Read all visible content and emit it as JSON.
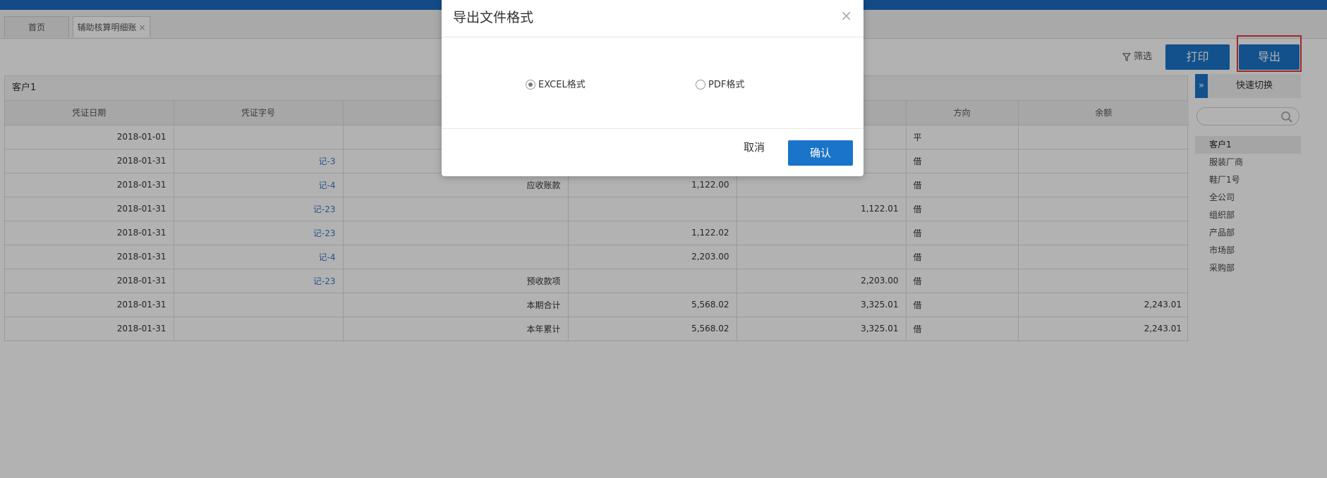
{
  "tabs": [
    {
      "label": "首页",
      "closable": false,
      "active": false
    },
    {
      "label": "辅助核算明细账",
      "closable": true,
      "active": true
    }
  ],
  "toolbar": {
    "filter_label": "筛选",
    "print_label": "打印",
    "export_label": "导出"
  },
  "ledger": {
    "title": "客户1",
    "columns": [
      "凭证日期",
      "凭证字号",
      "",
      "",
      "",
      "方向",
      "余额"
    ],
    "rows": [
      {
        "date": "2018-01-01",
        "voucher": "",
        "summary": "",
        "debit": "",
        "credit": "",
        "direction": "平",
        "balance": ""
      },
      {
        "date": "2018-01-31",
        "voucher": "记-3",
        "summary": "",
        "debit": "",
        "credit": "",
        "direction": "借",
        "balance": ""
      },
      {
        "date": "2018-01-31",
        "voucher": "记-4",
        "summary": "应收账款",
        "debit": "1,122.00",
        "credit": "",
        "direction": "借",
        "balance": ""
      },
      {
        "date": "2018-01-31",
        "voucher": "记-23",
        "summary": "",
        "debit": "",
        "credit": "1,122.01",
        "direction": "借",
        "balance": ""
      },
      {
        "date": "2018-01-31",
        "voucher": "记-23",
        "summary": "",
        "debit": "1,122.02",
        "credit": "",
        "direction": "借",
        "balance": ""
      },
      {
        "date": "2018-01-31",
        "voucher": "记-4",
        "summary": "",
        "debit": "2,203.00",
        "credit": "",
        "direction": "借",
        "balance": ""
      },
      {
        "date": "2018-01-31",
        "voucher": "记-23",
        "summary": "预收款项",
        "debit": "",
        "credit": "2,203.00",
        "direction": "借",
        "balance": ""
      },
      {
        "date": "2018-01-31",
        "voucher": "",
        "summary": "本期合计",
        "debit": "5,568.02",
        "credit": "3,325.01",
        "direction": "借",
        "balance": "2,243.01"
      },
      {
        "date": "2018-01-31",
        "voucher": "",
        "summary": "本年累计",
        "debit": "5,568.02",
        "credit": "3,325.01",
        "direction": "借",
        "balance": "2,243.01"
      }
    ]
  },
  "sidebar": {
    "toggle_icon": "»",
    "title": "快速切换",
    "search_placeholder": "",
    "items": [
      {
        "label": "客户1",
        "selected": true
      },
      {
        "label": "服装厂商",
        "selected": false
      },
      {
        "label": "鞋厂1号",
        "selected": false
      },
      {
        "label": "全公司",
        "selected": false
      },
      {
        "label": "组织部",
        "selected": false
      },
      {
        "label": "产品部",
        "selected": false
      },
      {
        "label": "市场部",
        "selected": false
      },
      {
        "label": "采购部",
        "selected": false
      }
    ]
  },
  "dialog": {
    "title": "导出文件格式",
    "close_glyph": "×",
    "options": [
      {
        "label": "EXCEL格式",
        "selected": true
      },
      {
        "label": "PDF格式",
        "selected": false
      }
    ],
    "cancel_label": "取消",
    "confirm_label": "确认"
  },
  "colors": {
    "accent": "#1a74c9",
    "link": "#3b79c7",
    "highlight": "#e23b3b"
  }
}
